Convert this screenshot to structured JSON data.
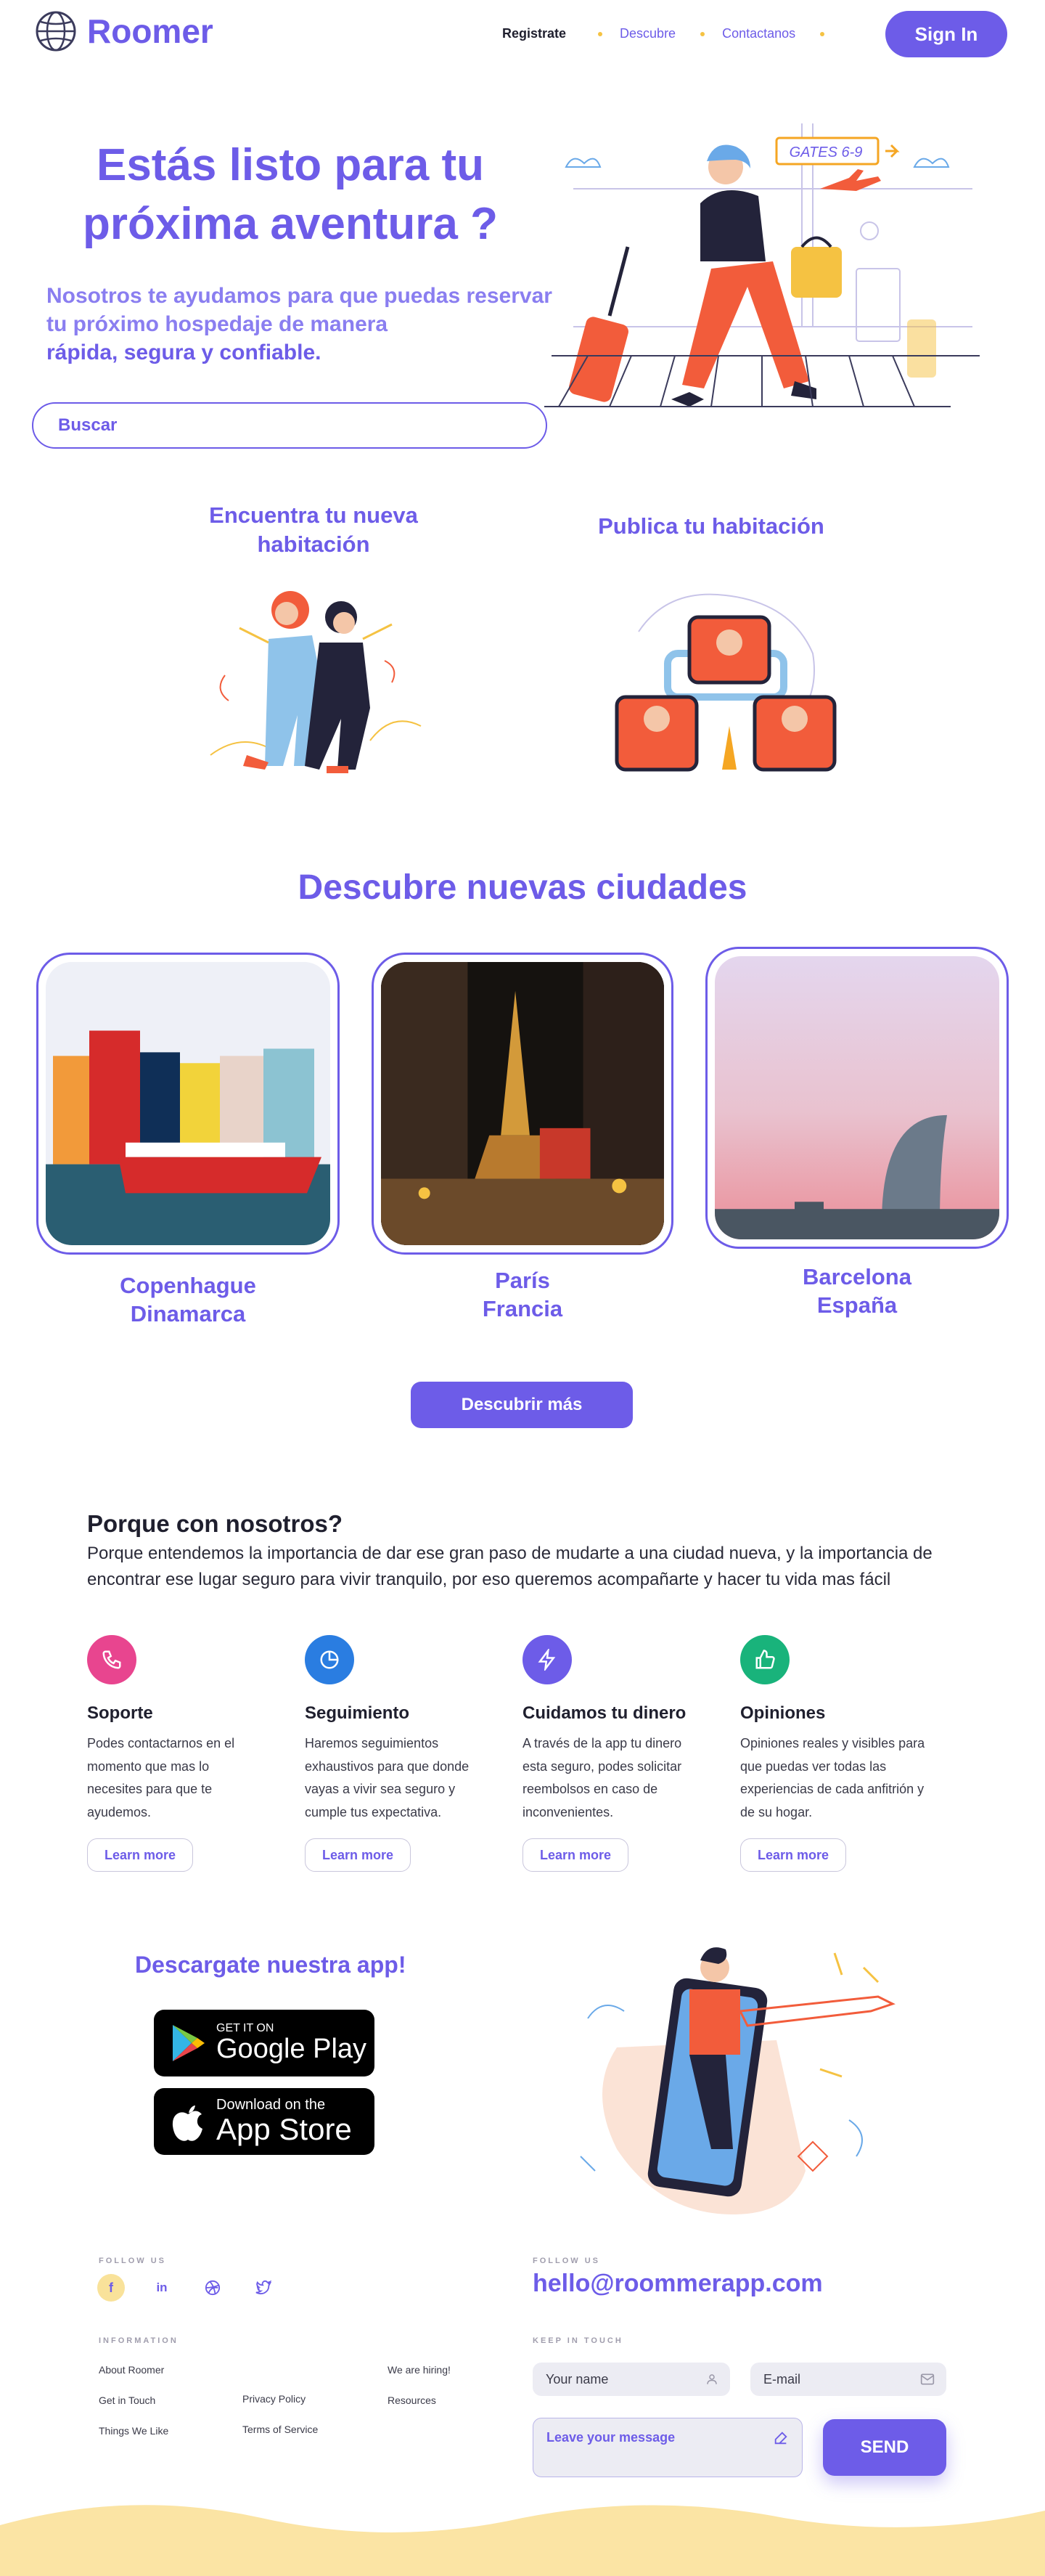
{
  "header": {
    "brand": "Roomer",
    "nav": [
      "Registrate",
      "Descubre",
      "Contactanos"
    ],
    "signin": "Sign In"
  },
  "hero": {
    "title_line1": "Estás listo para tu",
    "title_line2": "próxima aventura ?",
    "sub_line1": "Nosotros te ayudamos para que puedas reservar",
    "sub_line2": "tu próximo hospedaje de manera",
    "sub_line3": "rápida, segura y confiable.",
    "search_placeholder": "Buscar",
    "illustration_sign": "GATES 6-9"
  },
  "features": {
    "find_line1": "Encuentra tu nueva",
    "find_line2": "habitación",
    "publish": "Publica tu habitación"
  },
  "cities": {
    "title": "Descubre nuevas ciudades",
    "items": [
      {
        "city": "Copenhague",
        "country": "Dinamarca"
      },
      {
        "city": "París",
        "country": "Francia"
      },
      {
        "city": "Barcelona",
        "country": "España"
      }
    ],
    "more": "Descubrir más"
  },
  "why": {
    "title": "Porque con nosotros?",
    "text": "Porque entendemos la importancia de dar ese gran paso de mudarte a una ciudad nueva, y la importancia de encontrar ese lugar seguro para vivir tranquilo, por eso queremos acompañarte y hacer tu vida mas fácil",
    "cards": [
      {
        "title": "Soporte",
        "text": "Podes contactarnos en el momento que mas lo necesites para que te ayudemos.",
        "button": "Learn more",
        "icon": "phone-icon",
        "color": "#e8458f"
      },
      {
        "title": "Seguimiento",
        "text": "Haremos seguimientos exhaustivos para  que donde vayas a vivir sea seguro y cumple tus expectativa.",
        "button": "Learn more",
        "icon": "pie-chart-icon",
        "color": "#2a7de1"
      },
      {
        "title": "Cuidamos tu dinero",
        "text": "A través de la app tu dinero esta seguro, podes solicitar reembolsos en caso de inconvenientes.",
        "button": "Learn more",
        "icon": "bolt-icon",
        "color": "#6d5ce8"
      },
      {
        "title": "Opiniones",
        "text": "Opiniones reales y visibles para que puedas ver todas las experiencias de cada anfitrión y de su hogar.",
        "button": "Learn more",
        "icon": "thumbs-up-icon",
        "color": "#19b37b"
      }
    ]
  },
  "app": {
    "title": "Descargate  nuestra app!",
    "google_small": "GET IT ON",
    "google_big": "Google Play",
    "apple_small": "Download on the",
    "apple_big": "App Store"
  },
  "footer": {
    "follow_us": "FOLLOW US",
    "follow_us_2": "FOLLOW US",
    "email": "hello@roommerapp.com",
    "information": "INFORMATION",
    "keep_in_touch": "KEEP IN TOUCH",
    "links_col1": [
      "About Roomer",
      "Get in Touch",
      "Things We Like"
    ],
    "links_col2": [
      "Privacy Policy",
      "Terms of Service"
    ],
    "links_col3": [
      "We are hiring!",
      "Resources"
    ],
    "name_placeholder": "Your name",
    "email_placeholder": "E-mail",
    "message_placeholder": "Leave your message",
    "send": "SEND"
  }
}
